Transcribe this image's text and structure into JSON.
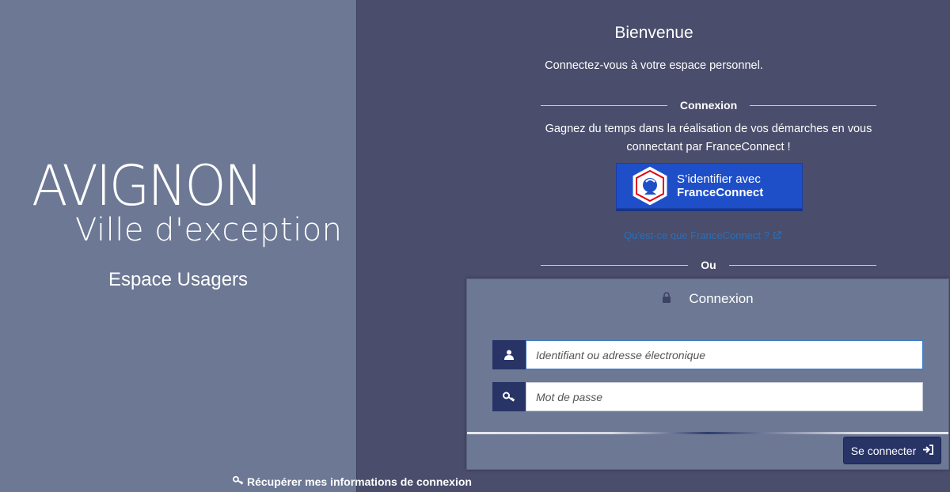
{
  "brand": {
    "logo_main": "AVIGNON",
    "logo_sub": "Ville d'exception",
    "space_title": "Espace Usagers"
  },
  "welcome": {
    "title": "Bienvenue",
    "subtitle": "Connectez-vous à votre espace personnel."
  },
  "franceconnect": {
    "divider_label": "Connexion",
    "text": "Gagnez du temps dans la réalisation de vos démarches en vous connectant par FranceConnect !",
    "button_line1": "S’identifier avec",
    "button_line2": "FranceConnect",
    "info_link": "Qu'est-ce que FranceConnect ?"
  },
  "or_label": "Ou",
  "login": {
    "title": "Connexion",
    "username_placeholder": "Identifiant ou adresse électronique",
    "password_placeholder": "Mot de passe",
    "submit_label": "Se connecter"
  },
  "recover_label": "Récupérer mes informations de connexion",
  "colors": {
    "left_panel": "#6c7894",
    "right_panel": "#4a4d6b",
    "franceconnect_blue": "#1e4fc9",
    "button_navy": "#283366"
  },
  "icons": {
    "lock": "lock-icon",
    "user": "user-icon",
    "key": "key-icon",
    "signin": "sign-in-icon",
    "external": "external-link-icon"
  }
}
